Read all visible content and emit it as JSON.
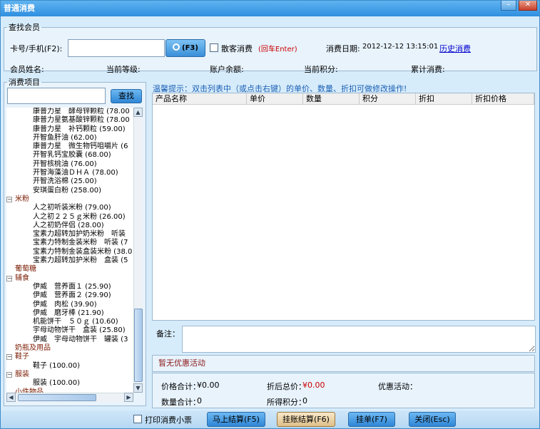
{
  "window": {
    "title": "普通消费",
    "minimize_glyph": "–",
    "close_glyph": "✕"
  },
  "member": {
    "legend": "查找会员",
    "card_label": "卡号/手机(F2):",
    "card_value": "",
    "search_button_label": "(F3)",
    "walkin_label": "散客消费",
    "walkin_hint": "(回车Enter)",
    "walkin_checked": false,
    "date_label": "消费日期:",
    "date_value": "2012-12-12 13:15:01",
    "history_link": "历史消费",
    "name_label": "会员姓名:",
    "level_label": "当前等级:",
    "balance_label": "账户余额:",
    "points_label": "当前积分:",
    "total_label": "累计消费:"
  },
  "items": {
    "legend": "消费项目",
    "search_value": "",
    "search_button": "查找",
    "tree": [
      {
        "kind": "item",
        "label": "康普力星　酵母锌颗粒 (78.00"
      },
      {
        "kind": "item",
        "label": "康普力星氨基酸锌颗粒 (78.00"
      },
      {
        "kind": "item",
        "label": "康普力星　补钙颗粒 (59.00)"
      },
      {
        "kind": "item",
        "label": "开智鱼肝油 (62.00)"
      },
      {
        "kind": "item",
        "label": "康普力星　微生物钙咀嚼片 (6"
      },
      {
        "kind": "item",
        "label": "开智乳钙宝胶囊 (68.00)"
      },
      {
        "kind": "item",
        "label": "开智核桃油 (76.00)"
      },
      {
        "kind": "item",
        "label": "开智海藻油ＤＨＡ (78.00)"
      },
      {
        "kind": "item",
        "label": "开智洗浴棉 (25.00)"
      },
      {
        "kind": "item",
        "label": "安琪蛋白粉 (258.00)"
      },
      {
        "kind": "cat",
        "label": "米粉",
        "expander": "−"
      },
      {
        "kind": "item",
        "label": "人之初听装米粉 (79.00)"
      },
      {
        "kind": "item",
        "label": "人之初２２５ｇ米粉 (26.00)"
      },
      {
        "kind": "item",
        "label": "人之初奶伴侣 (28.00)"
      },
      {
        "kind": "item",
        "label": "宝素力超转加护奶米粉　听装"
      },
      {
        "kind": "item",
        "label": "宝素力特制金装米粉　听装 (7"
      },
      {
        "kind": "item",
        "label": "宝素力特制金装盒装米粉 (38.0"
      },
      {
        "kind": "item",
        "label": "宝素力超转加护米粉　盒装 (5"
      },
      {
        "kind": "cat",
        "label": "葡萄糖",
        "expander": ""
      },
      {
        "kind": "cat",
        "label": "辅食",
        "expander": "−"
      },
      {
        "kind": "item",
        "label": "伊威　营养面１ (25.90)"
      },
      {
        "kind": "item",
        "label": "伊威　营养面２ (29.90)"
      },
      {
        "kind": "item",
        "label": "伊威　肉松 (39.90)"
      },
      {
        "kind": "item",
        "label": "伊威　磨牙棒 (21.90)"
      },
      {
        "kind": "item",
        "label": "机能饼干　５０ｇ (10.60)"
      },
      {
        "kind": "item",
        "label": "宇母动物饼干　盒装 (25.80)"
      },
      {
        "kind": "item",
        "label": "伊威　宇母动物饼干　罐装 (3"
      },
      {
        "kind": "cat",
        "label": "奶瓶及用品",
        "expander": ""
      },
      {
        "kind": "cat",
        "label": "鞋子",
        "expander": "−"
      },
      {
        "kind": "item",
        "label": "鞋子 (100.00)"
      },
      {
        "kind": "cat",
        "label": "服装",
        "expander": "−"
      },
      {
        "kind": "item",
        "label": "服装 (100.00)"
      },
      {
        "kind": "cat",
        "label": "小件物品",
        "expander": ""
      }
    ],
    "scroll_up": "▲",
    "scroll_down": "▼",
    "scroll_left": "◀",
    "scroll_right": "▶"
  },
  "cart": {
    "hint": "温馨提示：双击列表中（或点击右键）的单价、数量、折扣可做修改操作!",
    "columns": [
      "产品名称",
      "单价",
      "数量",
      "积分",
      "折扣",
      "折扣价格"
    ],
    "rows": [],
    "notes_label": "备注：",
    "notes_value": "",
    "promo_text": "暂无优惠活动"
  },
  "summary": {
    "price_total_label": "价格合计：",
    "price_total_value": "¥0.00",
    "discount_total_label": "折后总价：",
    "discount_total_value": "¥0.00",
    "promo_label": "优惠活动：",
    "qty_total_label": "数量合计：",
    "qty_total_value": "0",
    "points_earned_label": "所得积分：",
    "points_earned_value": "0"
  },
  "footer": {
    "print_label": "打印消费小票",
    "print_checked": false,
    "settle_button": "马上结算(F5)",
    "credit_button": "挂账结算(F6)",
    "hold_button": "挂单(F7)",
    "close_button": "关闭(Esc)"
  },
  "colors": {
    "title_bar": "#2f8fe0",
    "window_bg": "#d7ecfb",
    "accent_red": "#cc0000",
    "link": "#0000cc"
  }
}
